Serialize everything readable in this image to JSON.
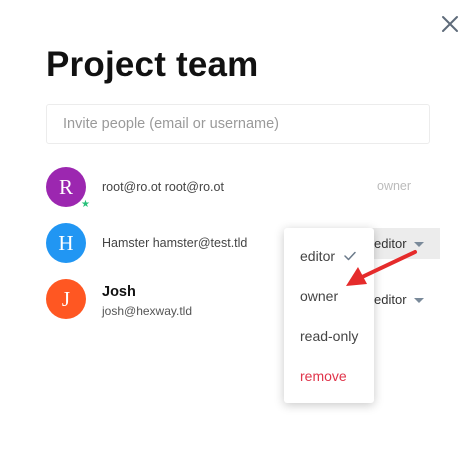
{
  "dialog": {
    "title": "Project team",
    "invite_placeholder": "Invite people (email or username)"
  },
  "members": [
    {
      "initial": "R",
      "color": "#9c27b0",
      "text": "root@ro.ot root@ro.ot",
      "role": "owner",
      "online": true
    },
    {
      "initial": "H",
      "color": "#2196f3",
      "text": "Hamster hamster@test.tld",
      "role": "editor"
    },
    {
      "initial": "J",
      "color": "#ff5722",
      "name": "Josh",
      "email": "josh@hexway.tld",
      "role": "editor"
    }
  ],
  "role_menu": {
    "items": [
      "editor",
      "owner",
      "read-only"
    ],
    "selected": "editor",
    "remove_label": "remove",
    "danger_color": "#e0344a"
  },
  "icons": {
    "close": "close-icon",
    "check": "check-icon",
    "caret": "chevron-down-icon",
    "pointer": "red-arrow",
    "online": "online-status-icon"
  },
  "accent_colors": {
    "arrow": "#e52b2b",
    "online": "#27c07a"
  }
}
